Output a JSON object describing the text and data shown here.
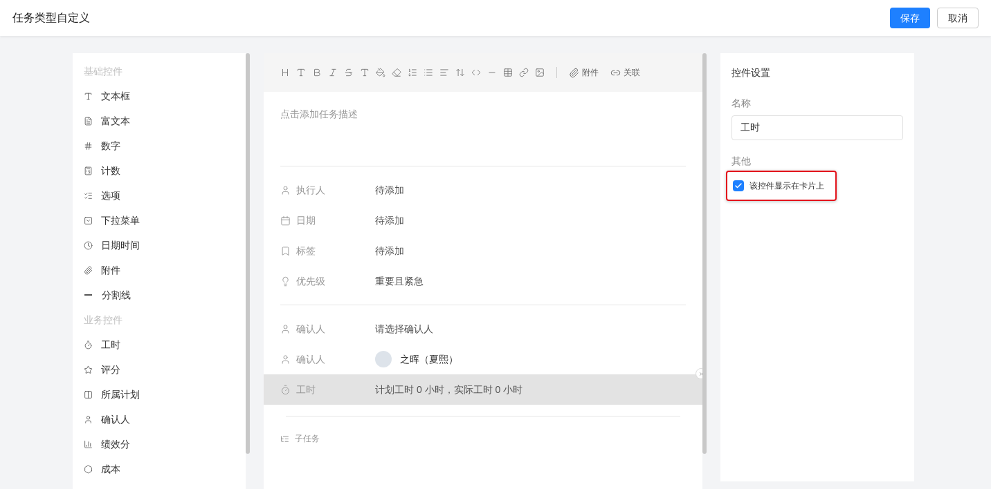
{
  "header": {
    "title": "任务类型自定义",
    "buttons": [
      {
        "label": "保存",
        "kind": "primary"
      },
      {
        "label": "取消",
        "kind": "default"
      }
    ]
  },
  "palette": {
    "sections": [
      {
        "title": "基础控件",
        "items": [
          {
            "label": "文本框"
          },
          {
            "label": "富文本"
          },
          {
            "label": "数字"
          },
          {
            "label": "计数"
          },
          {
            "label": "选项"
          },
          {
            "label": "下拉菜单"
          },
          {
            "label": "日期时间"
          },
          {
            "label": "附件"
          },
          {
            "label": "分割线"
          }
        ]
      },
      {
        "title": "业务控件",
        "items": [
          {
            "label": "工时"
          },
          {
            "label": "评分"
          },
          {
            "label": "所属计划"
          },
          {
            "label": "确认人"
          },
          {
            "label": "绩效分"
          },
          {
            "label": "成本"
          }
        ]
      }
    ]
  },
  "editor": {
    "toolbar": {
      "labeled_buttons": [
        "附件",
        "关联"
      ]
    },
    "description_placeholder": "点击添加任务描述",
    "field_groups": [
      [
        {
          "label": "执行人",
          "value": "待添加",
          "kind": "text",
          "selected": false
        },
        {
          "label": "日期",
          "value": "待添加",
          "kind": "text",
          "selected": false
        },
        {
          "label": "标签",
          "value": "待添加",
          "kind": "text",
          "selected": false
        },
        {
          "label": "优先级",
          "value": "重要且紧急",
          "kind": "text",
          "selected": false
        }
      ],
      [
        {
          "label": "确认人",
          "value": "请选择确认人",
          "kind": "text",
          "selected": false
        },
        {
          "label": "确认人",
          "value": "之晖（夏熙）",
          "kind": "person",
          "selected": false
        },
        {
          "label": "工时",
          "value": "计划工时 0 小时，实际工时 0 小时",
          "kind": "text",
          "selected": true
        }
      ]
    ],
    "subtask_label": "子任务"
  },
  "settings": {
    "title": "控件设置",
    "name_label": "名称",
    "name_value": "工时",
    "other_label": "其他",
    "checkbox": {
      "label": "该控件显示在卡片上",
      "checked": true,
      "highlighted": true
    }
  }
}
